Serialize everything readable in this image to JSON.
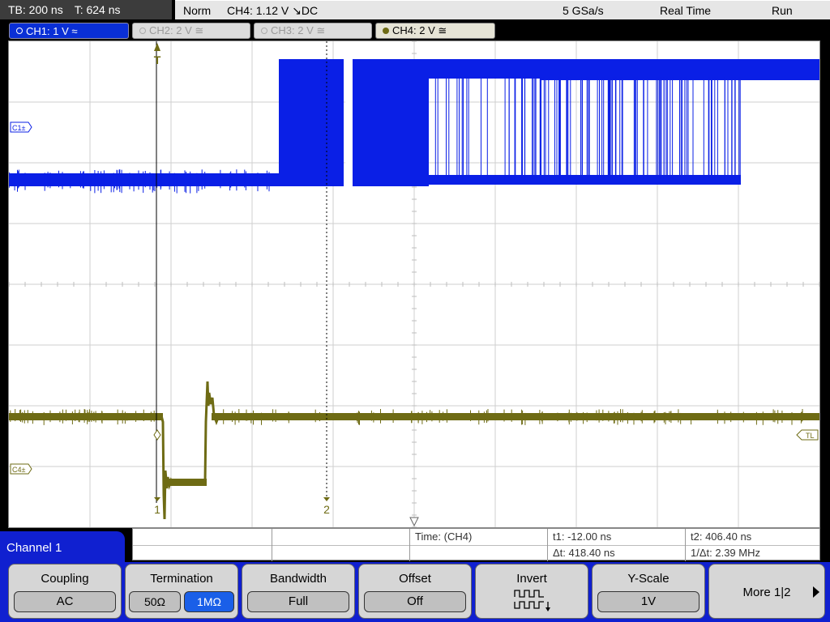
{
  "topbar": {
    "timebase": "TB: 200 ns",
    "trigger_time": "T: 624 ns",
    "mode": "Norm",
    "trigger": "CH4: 1.12 V ↘DC",
    "sample_rate": "5 GSa/s",
    "acq_mode": "Real Time",
    "run_state": "Run"
  },
  "channels": {
    "ch1": "CH1: 1 V ≈",
    "ch2": "CH2: 2 V ≅",
    "ch3": "CH3: 2 V ≅",
    "ch4": "CH4: 2 V ≅"
  },
  "markers": {
    "trigger": "T",
    "ch1": "C1±",
    "ch4": "C4±",
    "trigger_level": "TL",
    "cursor1": "1",
    "cursor2": "2"
  },
  "colors": {
    "ch1": "#0a1fe6",
    "ch4": "#6e6b14",
    "grid": "#c8c8c8",
    "softkey_bar": "#1020d0"
  },
  "measurements": {
    "label": "Time:  (CH4)",
    "t1": "t1: -12.00 ns",
    "t2": "t2: 406.40 ns",
    "dt": "Δt: 418.40 ns",
    "inv_dt": "1/Δt: 2.39 MHz"
  },
  "menu": {
    "channel": "Channel 1",
    "coupling": {
      "title": "Coupling",
      "value": "AC"
    },
    "termination": {
      "title": "Termination",
      "opt1": "50Ω",
      "opt2": "1MΩ"
    },
    "bandwidth": {
      "title": "Bandwidth",
      "value": "Full"
    },
    "offset": {
      "title": "Offset",
      "value": "Off"
    },
    "invert": {
      "title": "Invert",
      "icon": "invert-square-wave-icon"
    },
    "yscale": {
      "title": "Y-Scale",
      "value": "1V"
    },
    "more": {
      "title": "More 1|2"
    }
  }
}
